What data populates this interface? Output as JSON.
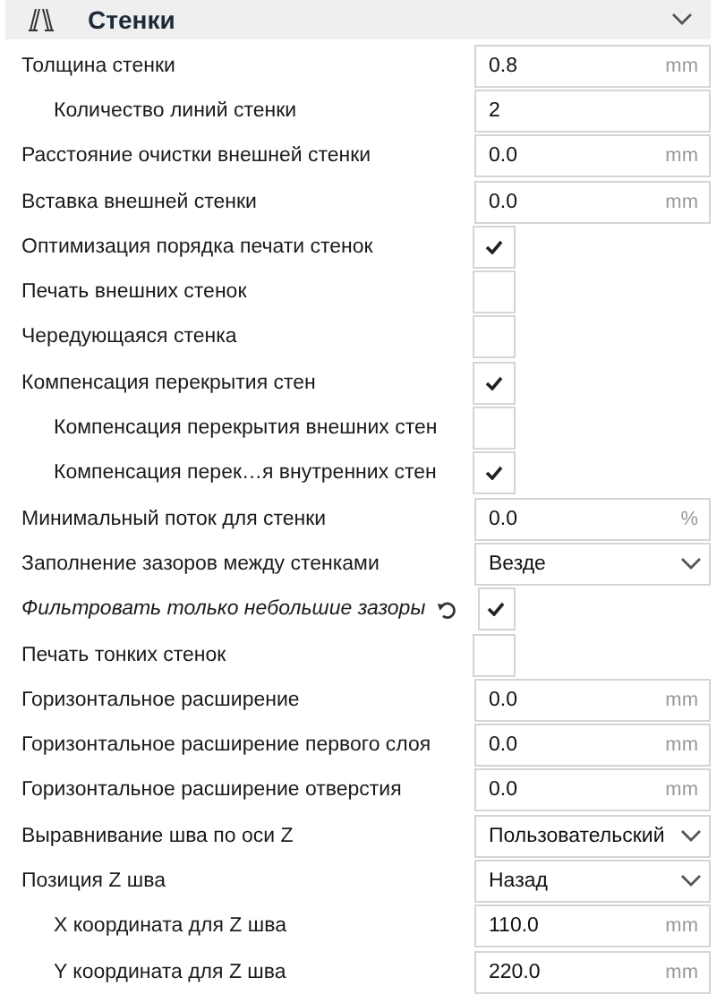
{
  "section": {
    "title": "Стенки",
    "expanded": true
  },
  "settings": [
    {
      "kind": "number",
      "label": "Толщина стенки",
      "value": "0.8",
      "unit": "mm",
      "children": [
        {
          "kind": "number",
          "label": "Количество линий стенки",
          "value": "2"
        }
      ]
    },
    {
      "kind": "number",
      "label": "Расстояние очистки внешней стенки",
      "value": "0.0",
      "unit": "mm"
    },
    {
      "kind": "number",
      "label": "Вставка внешней стенки",
      "value": "0.0",
      "unit": "mm"
    },
    {
      "kind": "checkbox",
      "label": "Оптимизация порядка печати стенок",
      "checked": true
    },
    {
      "kind": "checkbox",
      "label": "Печать внешних стенок",
      "checked": false
    },
    {
      "kind": "checkbox",
      "label": "Чередующаяся стенка",
      "checked": false
    },
    {
      "kind": "checkbox",
      "label": "Компенсация перекрытия стен",
      "checked": true,
      "children": [
        {
          "kind": "checkbox",
          "label": "Компенсация перекрытия внешних стен",
          "checked": false
        },
        {
          "kind": "checkbox",
          "label": "Компенсация перек…я внутренних стен",
          "checked": true
        }
      ]
    },
    {
      "kind": "number",
      "label": "Минимальный поток для стенки",
      "value": "0.0",
      "unit": "%"
    },
    {
      "kind": "dropdown",
      "label": "Заполнение зазоров между стенками",
      "value": "Везде"
    },
    {
      "kind": "checkbox",
      "label": "Фильтровать только небольшие зазоры",
      "checked": true,
      "overridden": true
    },
    {
      "kind": "checkbox",
      "label": "Печать тонких стенок",
      "checked": false
    },
    {
      "kind": "number",
      "label": "Горизонтальное расширение",
      "value": "0.0",
      "unit": "mm"
    },
    {
      "kind": "number",
      "label": "Горизонтальное расширение первого слоя",
      "value": "0.0",
      "unit": "mm"
    },
    {
      "kind": "number",
      "label": "Горизонтальное расширение отверстия",
      "value": "0.0",
      "unit": "mm"
    },
    {
      "kind": "dropdown",
      "label": "Выравнивание шва по оси Z",
      "value": "Пользовательский"
    },
    {
      "kind": "dropdown",
      "label": "Позиция Z шва",
      "value": "Назад",
      "children": [
        {
          "kind": "number",
          "label": "X координата для Z шва",
          "value": "110.0",
          "unit": "mm"
        },
        {
          "kind": "number",
          "label": "Y координата для Z шва",
          "value": "220.0",
          "unit": "mm"
        }
      ]
    }
  ]
}
